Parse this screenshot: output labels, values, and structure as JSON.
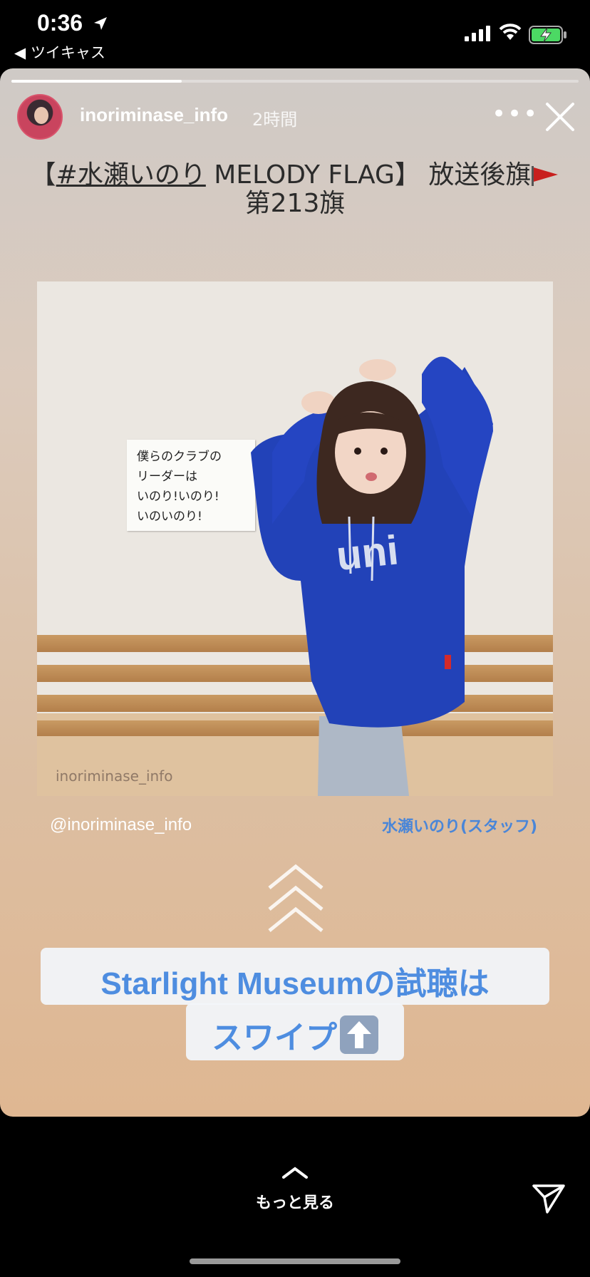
{
  "status_bar": {
    "time": "0:36",
    "back_app": "◀ ツイキャス",
    "icons": [
      "location-arrow-icon",
      "signal-icon",
      "wifi-icon",
      "battery-charging-icon"
    ]
  },
  "story": {
    "progress": 0.3,
    "username": "inoriminase_info",
    "time_ago": "2時間",
    "more_label": "•••",
    "headline": {
      "prefix": "【",
      "hashtag": "#水瀬いのり",
      "show": " MELODY FLAG】 放送後旗",
      "line2": "第213旗"
    },
    "photo": {
      "memo_lines": [
        "僕らのクラブの",
        "リーダーは",
        "いのり!いのり!",
        "いのいのり!"
      ],
      "watermark": "inoriminase_info"
    },
    "mention": "@inoriminase_info",
    "staff_label": "水瀬いのり(スタッフ)",
    "sticker_line1": "Starlight Museumの試聴は",
    "sticker_line2": "スワイプ"
  },
  "bottom": {
    "see_more": "もっと見る"
  },
  "colors": {
    "accent_blue": "#4e8de0",
    "flag_red": "#c8201e",
    "sweater_blue": "#2242b8"
  }
}
